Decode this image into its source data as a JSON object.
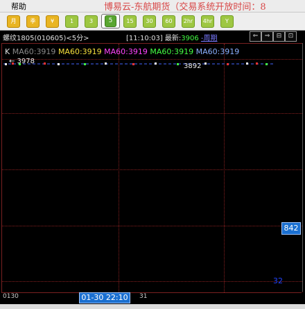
{
  "menubar": {
    "help": "帮助",
    "banner": "博易云-东航期货（交易系统开放时间：8"
  },
  "toolbar": {
    "buttons": [
      {
        "label": "月",
        "color": "y"
      },
      {
        "label": "季",
        "color": "y"
      },
      {
        "label": "¥",
        "color": "y"
      },
      {
        "label": "1",
        "color": "g"
      },
      {
        "label": "3",
        "color": "g"
      },
      {
        "label": "5",
        "color": "g",
        "selected": true
      },
      {
        "label": "15",
        "color": "g"
      },
      {
        "label": "30",
        "color": "g"
      },
      {
        "label": "60",
        "color": "g"
      },
      {
        "label": "2hr",
        "color": "g"
      },
      {
        "label": "4hr",
        "color": "g"
      },
      {
        "label": "Y",
        "color": "g"
      }
    ]
  },
  "info": {
    "title": "螺纹1805(010605)<5分>",
    "time": "[11:10:03]",
    "latest_label": "最新:",
    "latest_price": "3906",
    "period_link": "-周期",
    "nav": [
      "⇐",
      "⇒",
      "⊟",
      "⊡"
    ]
  },
  "chart": {
    "k_label": "K",
    "ma_items": [
      {
        "text": "MA60:3919",
        "color": "gray"
      },
      {
        "text": "MA60:3919",
        "color": "yellow"
      },
      {
        "text": "MA60:3919",
        "color": "magenta"
      },
      {
        "text": "MA60:3919",
        "color": "green"
      },
      {
        "text": "MA60:3919",
        "color": "blue"
      }
    ],
    "high_label": "← 3978",
    "low_label": "3892",
    "price_tag": "842",
    "volume_value": "32"
  },
  "timebar": {
    "left": "0130",
    "cursor": "01-30 22:10",
    "right": "31"
  }
}
